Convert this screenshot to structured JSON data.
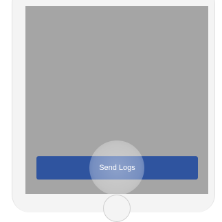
{
  "screen": {
    "send_logs_button": {
      "label": "Send Logs"
    }
  },
  "colors": {
    "screen_background": "#a5a5a5",
    "button_background": "#2f549f",
    "button_text": "#ffffff",
    "device_frame": "#f4f4f4"
  },
  "icons": {
    "home_button": "home-button-icon",
    "touch_indicator": "touch-indicator-icon"
  }
}
